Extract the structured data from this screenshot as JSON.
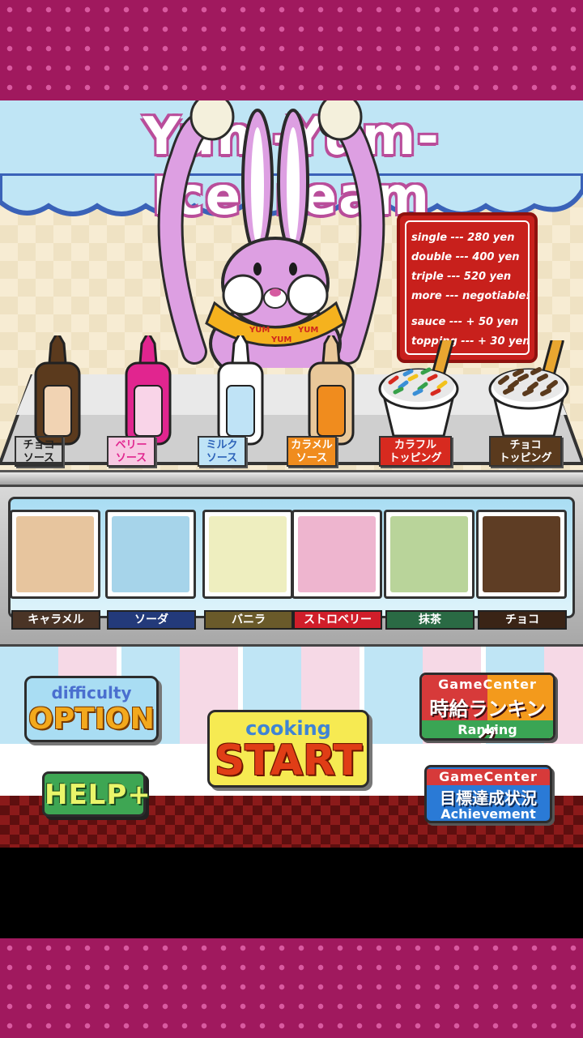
{
  "header": {
    "title": "Yum-Yum-Icecream"
  },
  "menu_board": {
    "lines": [
      "single --- 280 yen",
      "double --- 400 yen",
      "triple --- 520 yen",
      "more --- negotiable!",
      "sauce --- + 50 yen",
      "topping --- + 30 yen"
    ]
  },
  "rabbit": {
    "scarf_text_1": "YUM",
    "scarf_text_2": "YUM",
    "scarf_text_3": "YUM"
  },
  "sauces": [
    {
      "label_1": "チョコ",
      "label_2": "ソース",
      "bottle_color": "#5b3a1d",
      "tag_color": "#f4dfc3",
      "text_color": "#222"
    },
    {
      "label_1": "ベリー",
      "label_2": "ソース",
      "bottle_color": "#e1258f",
      "tag_color": "#f7c9e2",
      "text_color": "#e1258f"
    },
    {
      "label_1": "ミルク",
      "label_2": "ソース",
      "bottle_color": "#ffffff",
      "tag_color": "#bfe3f6",
      "text_color": "#2d63b9"
    },
    {
      "label_1": "カラメル",
      "label_2": "ソース",
      "bottle_color": "#ef8a1e",
      "tag_color": "#f08c1e",
      "text_color": "#fff"
    }
  ],
  "toppings": [
    {
      "label_1": "カラフル",
      "label_2": "トッピング",
      "tag_color": "#d72a1f"
    },
    {
      "label_1": "チョコ",
      "label_2": "トッピング",
      "tag_color": "#5a3a1d"
    }
  ],
  "flavors": [
    {
      "name": "キャラメル",
      "color": "#e7c59e",
      "tag_color": "#4a3426"
    },
    {
      "name": "ソーダ",
      "color": "#a6d4ea",
      "tag_color": "#233a7a"
    },
    {
      "name": "バニラ",
      "color": "#eeeebf",
      "tag_color": "#6a5a2a"
    },
    {
      "name": "ストロベリー",
      "color": "#eeb5cf",
      "tag_color": "#d01e2a"
    },
    {
      "name": "抹茶",
      "color": "#b9d49a",
      "tag_color": "#2a6a44"
    },
    {
      "name": "チョコ",
      "color": "#5e3d24",
      "tag_color": "#3a2416"
    }
  ],
  "buttons": {
    "option": {
      "sub": "difficulty",
      "main": "OPTION"
    },
    "start": {
      "sub": "cooking",
      "main": "START"
    },
    "help": {
      "main": "HELP+"
    },
    "ranking": {
      "top": "GameCenter",
      "mid": "時給ランキング",
      "bottom": "Ranking"
    },
    "achievement": {
      "top": "GameCenter",
      "mid": "目標達成状況",
      "bottom": "Achievement"
    }
  }
}
